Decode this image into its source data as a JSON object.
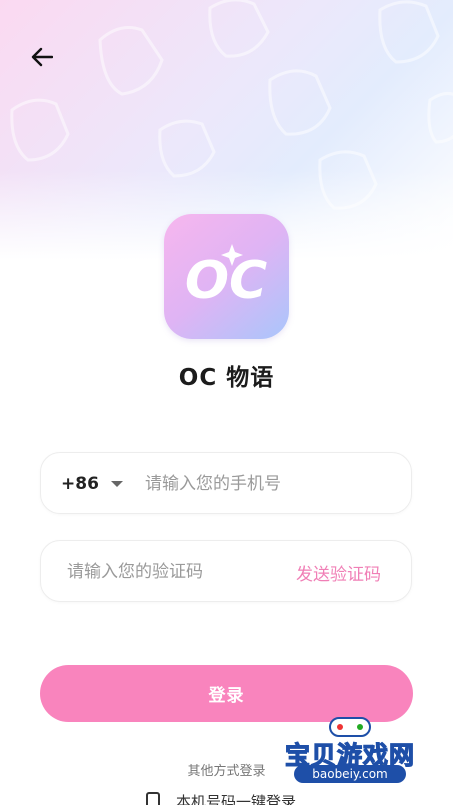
{
  "header": {
    "back_icon": "arrow-left-icon"
  },
  "app": {
    "logo_text": "OC",
    "name": "OC 物语"
  },
  "phone_field": {
    "country_code": "+86",
    "placeholder": "请输入您的手机号"
  },
  "code_field": {
    "placeholder": "请输入您的验证码",
    "send_code_label": "发送验证码"
  },
  "login_button": {
    "label": "登录"
  },
  "other_login": {
    "title": "其他方式登录",
    "one_click_label": "本机号码一键登录"
  },
  "watermark": {
    "text": "宝贝游戏网",
    "url": "baobeiy.com"
  },
  "colors": {
    "accent": "#f984bd",
    "send_code": "#f07fb6",
    "logo_gradient_start": "#f7b6ee",
    "logo_gradient_end": "#a9c6fb"
  }
}
